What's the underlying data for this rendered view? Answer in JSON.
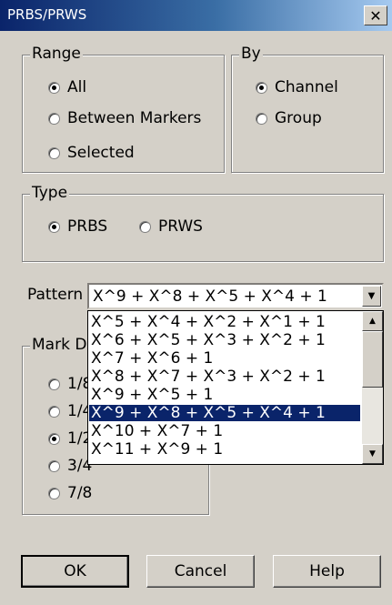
{
  "window": {
    "title": "PRBS/PRWS",
    "close_label": "✕"
  },
  "range": {
    "legend": "Range",
    "options": [
      {
        "label": "All",
        "checked": true
      },
      {
        "label": "Between Markers",
        "checked": false
      },
      {
        "label": "Selected",
        "checked": false
      }
    ]
  },
  "by": {
    "legend": "By",
    "options": [
      {
        "label": "Channel",
        "checked": true
      },
      {
        "label": "Group",
        "checked": false
      }
    ]
  },
  "type": {
    "legend": "Type",
    "options": [
      {
        "label": "PRBS",
        "checked": true
      },
      {
        "label": "PRWS",
        "checked": false
      }
    ]
  },
  "pattern": {
    "label": "Pattern",
    "value": "X^9 + X^8 + X^5 + X^4 + 1",
    "options": [
      "X^5 + X^4 + X^2 + X^1 + 1",
      "X^6 + X^5 + X^3 + X^2 + 1",
      "X^7 + X^6 + 1",
      "X^8 + X^7 + X^3 + X^2 + 1",
      "X^9 + X^5 + 1",
      "X^9 + X^8 + X^5 + X^4 + 1",
      "X^10 + X^7 + 1",
      "X^11 + X^9 + 1"
    ],
    "selected_index": 5
  },
  "mark": {
    "legend": "Mark De",
    "options": [
      {
        "label": "1/8",
        "checked": false
      },
      {
        "label": "1/4",
        "checked": false
      },
      {
        "label": "1/2",
        "checked": true
      },
      {
        "label": "3/4",
        "checked": false
      },
      {
        "label": "7/8",
        "checked": false
      }
    ]
  },
  "buttons": {
    "ok": "OK",
    "cancel": "Cancel",
    "help": "Help"
  }
}
